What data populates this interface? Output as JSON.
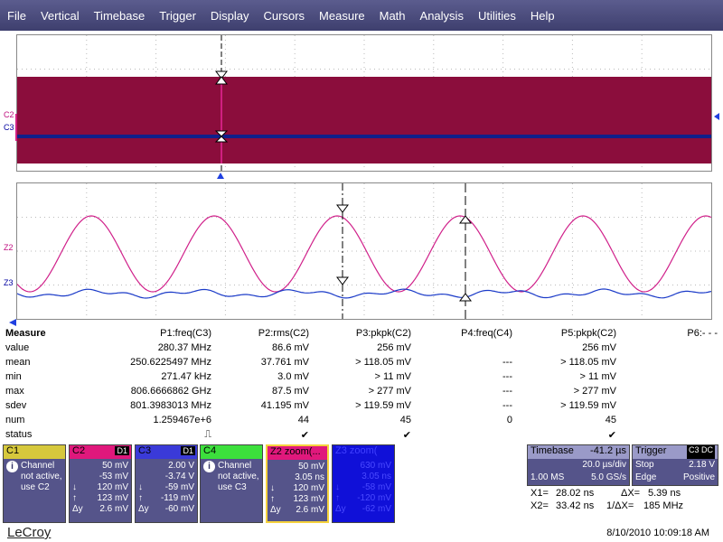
{
  "menu": [
    "File",
    "Vertical",
    "Timebase",
    "Trigger",
    "Display",
    "Cursors",
    "Measure",
    "Math",
    "Analysis",
    "Utilities",
    "Help"
  ],
  "trace_labels": {
    "c2": "C2",
    "c3": "C3",
    "z2": "Z2",
    "z3": "Z3"
  },
  "measure": {
    "header": [
      "Measure",
      "P1:freq(C3)",
      "P2:rms(C2)",
      "P3:pkpk(C2)",
      "P4:freq(C4)",
      "P5:pkpk(C2)",
      "P6:- - -"
    ],
    "rows": [
      [
        "value",
        "280.37 MHz",
        "86.6 mV",
        "256 mV",
        "",
        "256 mV",
        ""
      ],
      [
        "mean",
        "250.6225497 MHz",
        "37.761 mV",
        "> 118.05 mV",
        "---",
        "> 118.05 mV",
        ""
      ],
      [
        "min",
        "271.47 kHz",
        "3.0 mV",
        "> 11 mV",
        "---",
        "> 11 mV",
        ""
      ],
      [
        "max",
        "806.6666862 GHz",
        "87.5 mV",
        "> 277 mV",
        "---",
        "> 277 mV",
        ""
      ],
      [
        "sdev",
        "801.3983013 MHz",
        "41.195 mV",
        "> 119.59 mV",
        "---",
        "> 119.59 mV",
        ""
      ],
      [
        "num",
        "1.259467e+6",
        "44",
        "45",
        "0",
        "45",
        ""
      ],
      [
        "status",
        "⎍",
        "✔",
        "✔",
        "",
        "✔",
        ""
      ]
    ]
  },
  "channels": {
    "c1": {
      "title": "C1",
      "note": [
        "Channel",
        "not active,",
        "use C2"
      ]
    },
    "c2": {
      "title": "C2",
      "tag": "D1",
      "rows": [
        [
          "",
          "50 mV"
        ],
        [
          "",
          "-53 mV"
        ],
        [
          "↓",
          "120 mV"
        ],
        [
          "↑",
          "123 mV"
        ],
        [
          "Δy",
          "2.6 mV"
        ]
      ]
    },
    "c3": {
      "title": "C3",
      "tag": "D1",
      "rows": [
        [
          "",
          "2.00 V"
        ],
        [
          "",
          "-3.74 V"
        ],
        [
          "↓",
          "-59 mV"
        ],
        [
          "↑",
          "-119 mV"
        ],
        [
          "Δy",
          "-60 mV"
        ]
      ]
    },
    "c4": {
      "title": "C4",
      "note": [
        "Channel",
        "not active,",
        "use C3"
      ]
    },
    "z2": {
      "title": "Z2 zoom(...",
      "rows": [
        [
          "",
          "50 mV"
        ],
        [
          "",
          "3.05 ns"
        ],
        [
          "↓",
          "120 mV"
        ],
        [
          "↑",
          "123 mV"
        ],
        [
          "Δy",
          "2.6 mV"
        ]
      ]
    },
    "z3": {
      "title": "Z3 zoom(",
      "rows": [
        [
          "",
          "630 mV"
        ],
        [
          "",
          "3.05 ns"
        ],
        [
          "↓",
          "-58 mV"
        ],
        [
          "↑",
          "-120 mV"
        ],
        [
          "Δy",
          "-62 mV"
        ]
      ]
    }
  },
  "timebase": {
    "label": "Timebase",
    "delay": "-41.2 µs",
    "div": "20.0 µs/div",
    "samples": "1.00 MS",
    "rate": "5.0 GS/s"
  },
  "trigger": {
    "label": "Trigger",
    "tag": "C3 DC",
    "mode": "Stop",
    "level": "2.18 V",
    "type": "Edge",
    "slope": "Positive"
  },
  "cursors": {
    "x1": "X1=",
    "x1v": "28.02 ns",
    "dx": "ΔX=",
    "dxv": "5.39 ns",
    "x2": "X2=",
    "x2v": "33.42 ns",
    "inv": "1/ΔX=",
    "invv": "185 MHz"
  },
  "brand": "LeCroy",
  "datetime": "8/10/2010 10:09:18 AM",
  "colors": {
    "c2_trace": "#8b0d3c",
    "c3_trace": "#10208a",
    "z2_trace": "#d0208a",
    "z3_trace": "#1a3ac8"
  }
}
